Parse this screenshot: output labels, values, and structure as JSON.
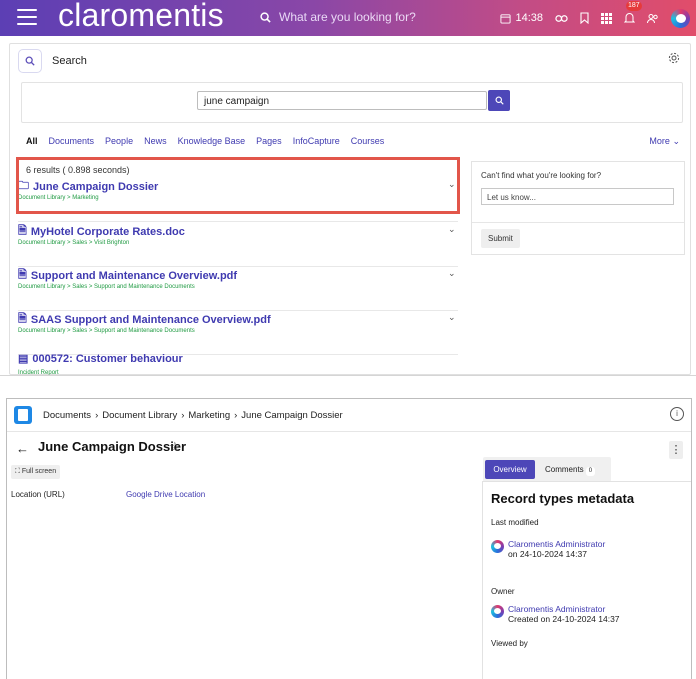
{
  "topbar": {
    "logo": "claromentis",
    "search_placeholder": "What are you looking for?",
    "time": "14:38",
    "notifications_count": "187"
  },
  "search_page": {
    "header_label": "Search",
    "query": "june campaign",
    "filters": [
      "All",
      "Documents",
      "People",
      "News",
      "Knowledge Base",
      "Pages",
      "InfoCapture",
      "Courses"
    ],
    "more_label": "More",
    "results_count": "6 results ( 0.898 seconds)",
    "results": [
      {
        "title": "June Campaign Dossier",
        "path": "Document Library > Marketing"
      },
      {
        "title": "MyHotel Corporate Rates.doc",
        "path": "Document Library > Sales > Visit Brighton"
      },
      {
        "title": "Support and Maintenance Overview.pdf",
        "path": "Document Library > Sales > Support and Maintenance Documents"
      },
      {
        "title": "SAAS Support and Maintenance Overview.pdf",
        "path": "Document Library > Sales > Support and Maintenance Documents"
      },
      {
        "title": "000572: Customer behaviour",
        "path": "Incident Report"
      }
    ],
    "side": {
      "question": "Can't find what you're looking for?",
      "input_placeholder": "Let us know...",
      "submit_label": "Submit"
    }
  },
  "document_page": {
    "breadcrumb": [
      "Documents",
      "Document Library",
      "Marketing",
      "June Campaign Dossier"
    ],
    "title": "June Campaign Dossier",
    "full_screen_label": "Full screen",
    "location_label": "Location (URL)",
    "location_link": "Google Drive Location",
    "tabs": {
      "overview": "Overview",
      "comments": "Comments",
      "comments_count": "0"
    },
    "metadata": {
      "heading": "Record types metadata",
      "last_modified_label": "Last modified",
      "last_modified_user": "Claromentis Administrator",
      "last_modified_date": "on 24-10-2024 14:37",
      "owner_label": "Owner",
      "owner_user": "Claromentis Administrator",
      "owner_created": "Created on 24-10-2024 14:37",
      "viewed_by_label": "Viewed by"
    }
  }
}
